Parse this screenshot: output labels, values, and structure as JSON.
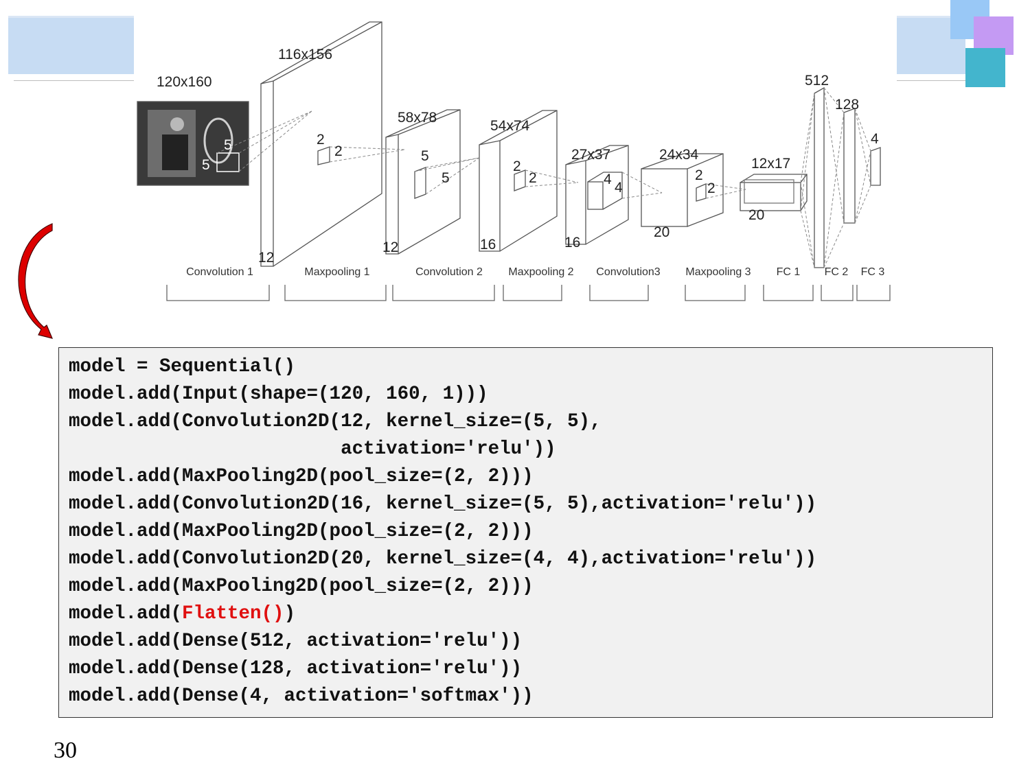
{
  "diagram": {
    "dims": {
      "input": "120x160",
      "conv1": "116x156",
      "pool1": "58x78",
      "conv2": "54x74",
      "pool2": "27x37",
      "conv3": "24x34",
      "pool3": "12x17",
      "fc1": "512",
      "fc2": "128",
      "fc3": "4"
    },
    "depths": {
      "conv1": "12",
      "pool1": "12",
      "conv2": "16",
      "pool2": "16",
      "conv3": "20",
      "pool3": "20"
    },
    "kernels": {
      "k1": [
        "5",
        "5"
      ],
      "k2": [
        "2",
        "2"
      ],
      "k3": [
        "5",
        "5"
      ],
      "k4": [
        "2",
        "2"
      ],
      "k5": [
        "4",
        "4"
      ],
      "k6": [
        "2",
        "2"
      ]
    },
    "stages": [
      "Convolution 1",
      "Maxpooling 1",
      "Convolution 2",
      "Maxpooling 2",
      "Convolution3",
      "Maxpooling 3",
      "FC 1",
      "FC 2",
      "FC 3"
    ]
  },
  "code": {
    "lines": [
      "model = Sequential()",
      "model.add(Input(shape=(120, 160, 1)))",
      "model.add(Convolution2D(12, kernel_size=(5, 5),",
      "                        activation='relu'))",
      "model.add(MaxPooling2D(pool_size=(2, 2)))",
      "model.add(Convolution2D(16, kernel_size=(5, 5),activation='relu'))",
      "model.add(MaxPooling2D(pool_size=(2, 2)))",
      "model.add(Convolution2D(20, kernel_size=(4, 4),activation='relu'))",
      "model.add(MaxPooling2D(pool_size=(2, 2)))"
    ],
    "flatten_prefix": "model.add(",
    "flatten_highlight": "Flatten()",
    "flatten_suffix": ")",
    "tail_lines": [
      "model.add(Dense(512, activation='relu'))",
      "model.add(Dense(128, activation='relu'))",
      "model.add(Dense(4, activation='softmax'))"
    ]
  },
  "page_number": "30",
  "colors": {
    "highlight": "#e01010",
    "arrow": "#dd0000"
  }
}
